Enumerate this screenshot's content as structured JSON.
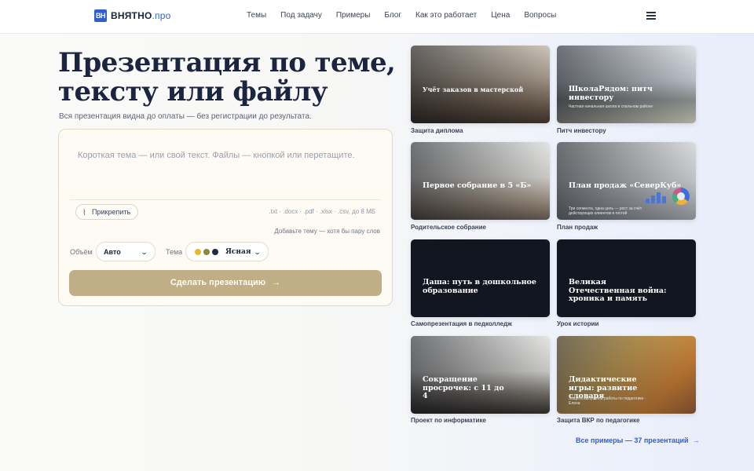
{
  "header": {
    "logo_mark": "ВН",
    "logo_main": "ВНЯТНО",
    "logo_accent": ".про",
    "nav": [
      "Темы",
      "Под задачу",
      "Примеры",
      "Блог",
      "Как это работает",
      "Цена",
      "Вопросы"
    ]
  },
  "hero": {
    "title": "Презентация по теме, тексту или файлу",
    "subtitle": "Вся презентация видна до оплаты — без регистрации до результата."
  },
  "form": {
    "placeholder": "Короткая тема — или свой текст. Файлы — кнопкой или перетащите.",
    "attach_label": "Прикрепить",
    "formats": ".txt · .docx · .pdf · .xlsx · .csv, до 8 МБ",
    "hint": "Добавьте тему — хотя бы пару слов",
    "volume_label": "Объём",
    "volume_value": "Авто",
    "theme_label": "Тема",
    "theme_value": "Ясная",
    "theme_colors": [
      "#e6b92b",
      "#8a8a3a",
      "#1f2a44"
    ],
    "submit_label": "Сделать презентацию",
    "submit_color": "#bfae86"
  },
  "gallery": {
    "items": [
      {
        "title": "Учёт заказов в мастерской",
        "caption": "Защита диплома"
      },
      {
        "title": "ШколаРядом: питч инвестору",
        "subtitle": "Частная начальная школа в спальном районе",
        "caption": "Питч инвестору"
      },
      {
        "title": "Первое собрание в 5 «Б»",
        "caption": "Родительское собрание"
      },
      {
        "title": "План продаж «СеверКуб»",
        "subtitle": "Три сегмента, одна цель — рост за счёт действующих клиентов и гостей",
        "caption": "План продаж"
      },
      {
        "title": "Даша: путь в дошкольное образование",
        "caption": "Самопрезентация в педколледж"
      },
      {
        "title": "Великая Отечественная война: хроника и память",
        "caption": "Урок истории"
      },
      {
        "title": "Сокращение просрочек: с 11 до 4",
        "caption": "Проект по информатике"
      },
      {
        "title": "Дидактические игры: развитие словаря",
        "subtitle": "Защита выпускной работы по педагогике · Елена",
        "caption": "Защита ВКР по педагогике"
      }
    ],
    "all_link": "Все примеры — 37 презентаций"
  },
  "icons": {
    "attach": "paperclip-icon",
    "chevron": "chevron-down-icon",
    "arrow": "arrow-right-icon",
    "menu": "hamburger-menu-icon"
  }
}
